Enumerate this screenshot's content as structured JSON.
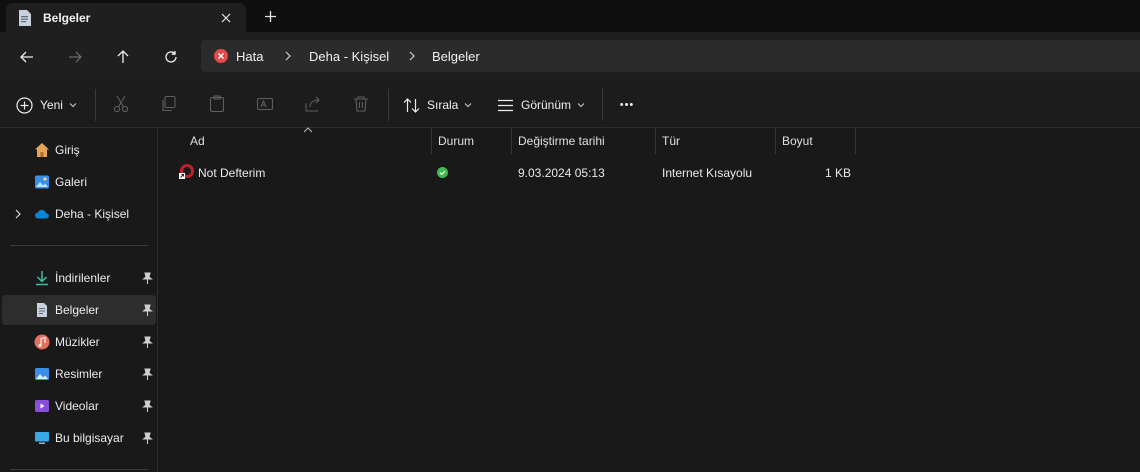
{
  "window": {
    "tab_title": "Belgeler",
    "icons": {
      "tab": "document-icon",
      "close": "close-icon",
      "new_tab": "plus-icon"
    }
  },
  "navigation": {
    "buttons": [
      "back-arrow-icon",
      "forward-arrow-icon",
      "up-arrow-icon",
      "refresh-icon"
    ],
    "breadcrumb": [
      "Hata",
      "Deha - Kişisel",
      "Belgeler"
    ]
  },
  "toolbar": {
    "new_label": "Yeni",
    "sort_label": "Sırala",
    "view_label": "Görünüm",
    "more_label": "•••",
    "disabled_actions": [
      "cut-icon",
      "copy-icon",
      "paste-icon",
      "rename-icon",
      "share-icon",
      "delete-icon"
    ]
  },
  "sidebar": {
    "top_items": [
      {
        "label": "Giriş",
        "icon": "home-icon"
      },
      {
        "label": "Galeri",
        "icon": "gallery-icon"
      },
      {
        "label": "Deha - Kişisel",
        "icon": "onedrive-cloud-icon"
      }
    ],
    "quick_access": [
      {
        "label": "İndirilenler",
        "icon": "download-icon",
        "pinned": true
      },
      {
        "label": "Belgeler",
        "icon": "document-icon",
        "pinned": true,
        "selected": true
      },
      {
        "label": "Müzikler",
        "icon": "music-icon",
        "pinned": true
      },
      {
        "label": "Resimler",
        "icon": "pictures-icon",
        "pinned": true
      },
      {
        "label": "Videolar",
        "icon": "videos-icon",
        "pinned": true
      },
      {
        "label": "Bu bilgisayar",
        "icon": "computer-icon",
        "pinned": true
      }
    ]
  },
  "file_list": {
    "columns": [
      "Ad",
      "Durum",
      "Değiştirme tarihi",
      "Tür",
      "Boyut"
    ],
    "rows": [
      {
        "name": "Not Defterim",
        "status": "synced",
        "modified": "9.03.2024 05:13",
        "type": "Internet Kısayolu",
        "size": "1 KB"
      }
    ]
  },
  "colors": {
    "accent": "#0a84d6",
    "error": "#e34a4a",
    "synced": "#3fb950",
    "background": "#191919"
  }
}
